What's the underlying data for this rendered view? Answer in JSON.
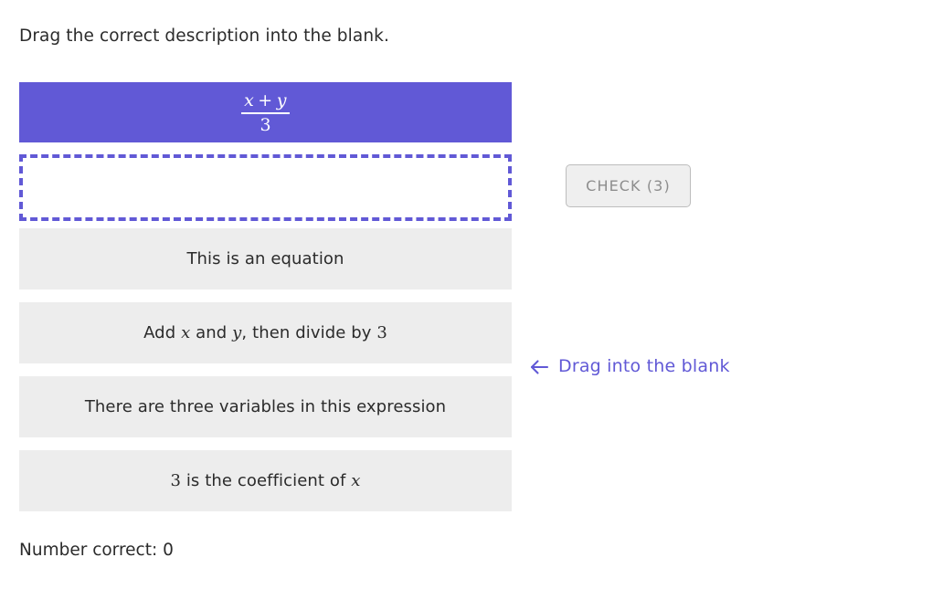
{
  "instruction": "Drag the correct description into the blank.",
  "expression": {
    "numerator_left": "x",
    "numerator_op": "+",
    "numerator_right": "y",
    "denominator": "3",
    "plain": "(x + y) / 3",
    "background_color": "#6159d6",
    "text_color": "#ffffff"
  },
  "blank": {
    "value": "",
    "placeholder": "",
    "border_color": "#6159d6",
    "border_style": "dashed"
  },
  "options": [
    {
      "id": "option-1",
      "parts": [
        {
          "type": "text",
          "value": "This is an equation"
        }
      ],
      "plain": "This is an equation"
    },
    {
      "id": "option-2",
      "parts": [
        {
          "type": "text",
          "value": "Add "
        },
        {
          "type": "math-var",
          "value": "x"
        },
        {
          "type": "text",
          "value": " and "
        },
        {
          "type": "math-var",
          "value": "y"
        },
        {
          "type": "text",
          "value": ", then divide by "
        },
        {
          "type": "math-num",
          "value": "3"
        }
      ],
      "plain": "Add x and y, then divide by 3"
    },
    {
      "id": "option-3",
      "parts": [
        {
          "type": "text",
          "value": "There are three variables in this expression"
        }
      ],
      "plain": "There are three variables in this expression"
    },
    {
      "id": "option-4",
      "parts": [
        {
          "type": "math-num",
          "value": "3"
        },
        {
          "type": "text",
          "value": " is the coefficient of "
        },
        {
          "type": "math-var",
          "value": "x"
        }
      ],
      "plain": "3 is the coefficient of x"
    }
  ],
  "check_button": {
    "label": "CHECK (3)",
    "attempts_remaining": 3,
    "background_color": "#efefef",
    "border_color": "#bdbdbd",
    "text_color": "#8d8d8d"
  },
  "drag_hint": {
    "icon": "arrow-left-icon",
    "label": "Drag into the blank",
    "color": "#6159d6"
  },
  "score": {
    "label": "Number correct: 0",
    "number_correct": 0
  }
}
